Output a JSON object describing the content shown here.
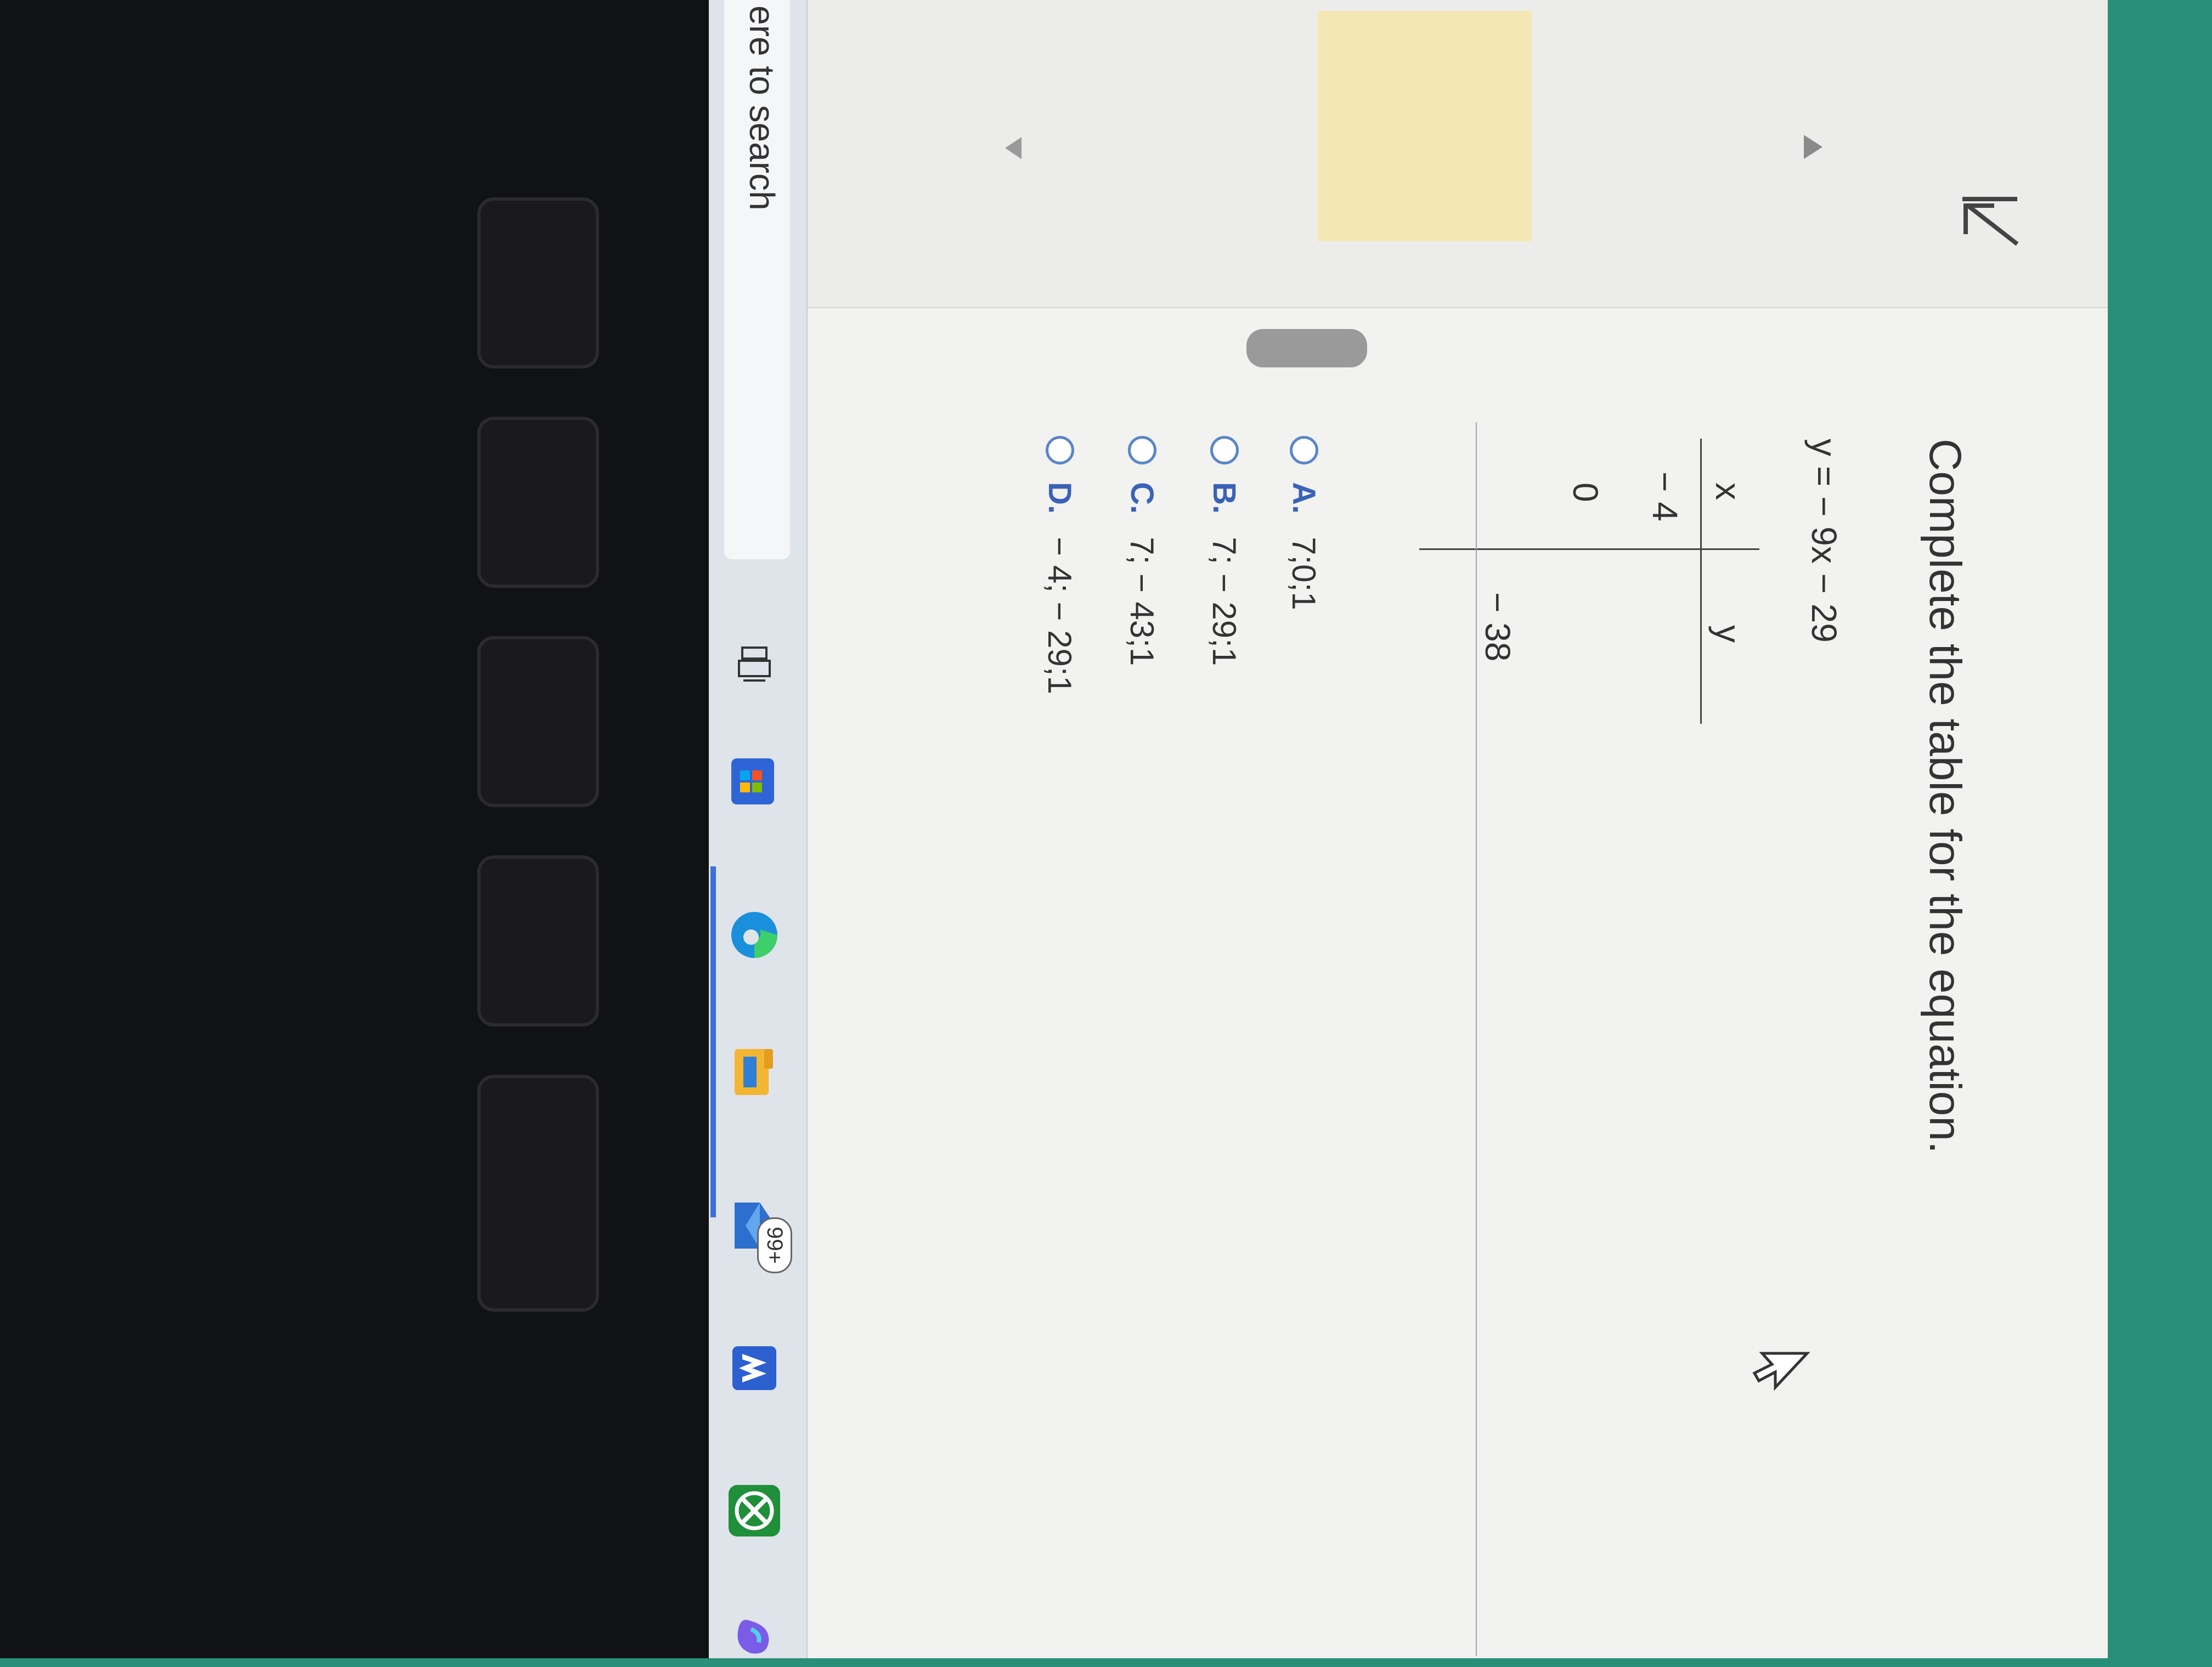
{
  "question": {
    "title": "Complete the table for the equation.",
    "equation": "y = − 9x − 29"
  },
  "table": {
    "headers": [
      "x",
      "y"
    ],
    "rows": [
      {
        "x": "− 4",
        "y": ""
      },
      {
        "x": "0",
        "y": ""
      },
      {
        "x": "",
        "y": "− 38"
      }
    ]
  },
  "choices": [
    {
      "letter": "A.",
      "text": "7;0;1"
    },
    {
      "letter": "B.",
      "text": "7; − 29;1"
    },
    {
      "letter": "C.",
      "text": "7; − 43;1"
    },
    {
      "letter": "D.",
      "text": "− 4; − 29;1"
    }
  ],
  "taskbar": {
    "search_text": "ere to search",
    "mail_badge": "99+"
  },
  "icons": {
    "back": "first-page-icon",
    "task_view": "task-view-icon",
    "store": "microsoft-store-icon",
    "edge": "edge-icon",
    "explorer": "file-explorer-icon",
    "mail": "mail-icon",
    "mcafee": "mcafee-icon",
    "xbox": "xbox-icon",
    "copilot": "copilot-icon",
    "cursor": "mouse-pointer-icon"
  }
}
